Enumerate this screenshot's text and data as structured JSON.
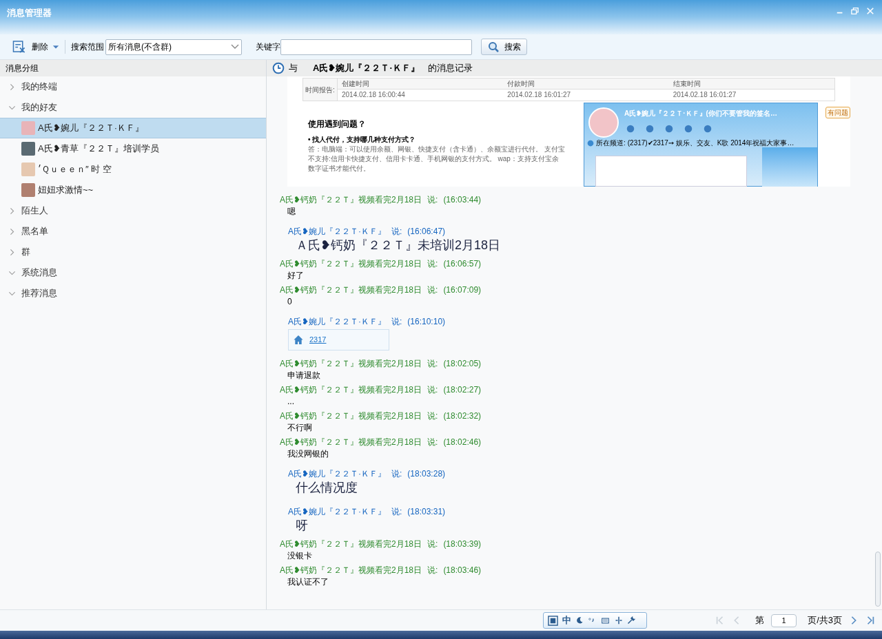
{
  "window": {
    "title": "消息管理器"
  },
  "toolbar": {
    "delete_label": "删除",
    "scope_label": "搜索范围",
    "scope_value": "所有消息(不含群)",
    "keyword_label": "关键字",
    "search_label": "搜索"
  },
  "sidebar": {
    "title": "消息分组",
    "groups": [
      {
        "label": "我的终端",
        "expanded": false
      },
      {
        "label": "我的好友",
        "expanded": true,
        "children": [
          {
            "label": "A氏❥婉儿『２２Ｔ·ＫＦ』",
            "selected": true
          },
          {
            "label": "A氏❥青草『２２Ｔ』培训学员",
            "selected": false
          },
          {
            "label": "׳Ｑｕｅｅｎ″ 时  空",
            "selected": false
          },
          {
            "label": "妞妞求激情~~",
            "selected": false
          }
        ]
      },
      {
        "label": "陌生人",
        "expanded": false
      },
      {
        "label": "黑名单",
        "expanded": false
      },
      {
        "label": "群",
        "expanded": false
      },
      {
        "label": "系统消息",
        "expanded": true
      },
      {
        "label": "推荐消息",
        "expanded": true
      }
    ]
  },
  "chat": {
    "header_prefix": "与",
    "header_name": "A氏❥婉儿『２２Ｔ·ＫＦ』",
    "header_suffix": "的消息记录",
    "embedded_image": {
      "table_label": "时间报告:",
      "columns": [
        "创建时间",
        "付款时间",
        "结束时间"
      ],
      "values": [
        "2014.02.18 16:00:44",
        "2014.02.18 16:01:27",
        "2014.02.18 16:01:27"
      ],
      "faq_title": "使用遇到问题？",
      "faq_question": "• 找人代付，支持哪几种支付方式？",
      "faq_lines": [
        "答：电脑端：可以使用余额、网银、快捷支付（含卡通）、余额宝进行代付。 支付宝",
        "不支持:信用卡快捷支付、信用卡卡通、手机网银的支付方式。 wap：支持支付宝余",
        "数字证书才能代付。"
      ],
      "side_tag": "有问题",
      "window_title": "A氏❥婉儿『２２Ｔ·ＫＦ』(你们不要管我的签名…",
      "channel_label": "所在频道:",
      "channel_text": "(2317)✔2317➙ 娱乐、交友、K歌 2014年祝福大家事…"
    },
    "messages": [
      {
        "kind": "incoming",
        "sender": "A氏❥钙奶『２２Ｔ』视频看完2月18日",
        "said": "说:",
        "time": "(16:03:44)",
        "body": {
          "kind": "text",
          "text": "嗯"
        }
      },
      {
        "kind": "outgoing",
        "sender": "A氏❥婉儿『２２Ｔ·ＫＦ』",
        "said": "说:",
        "time": "(16:06:47)",
        "body": {
          "kind": "large_text",
          "text": "Ａ氏❥钙奶『２２Ｔ』未培训2月18日"
        }
      },
      {
        "kind": "incoming",
        "sender": "A氏❥钙奶『２２Ｔ』视频看完2月18日",
        "said": "说:",
        "time": "(16:06:57)",
        "body": {
          "kind": "text",
          "text": "好了"
        }
      },
      {
        "kind": "incoming",
        "sender": "A氏❥钙奶『２２Ｔ』视频看完2月18日",
        "said": "说:",
        "time": "(16:07:09)",
        "body": {
          "kind": "text",
          "text": "0"
        }
      },
      {
        "kind": "outgoing",
        "sender": "A氏❥婉儿『２２Ｔ·ＫＦ』",
        "said": "说:",
        "time": "(16:10:10)",
        "body": {
          "kind": "link",
          "text": "2317"
        }
      },
      {
        "kind": "incoming",
        "sender": "A氏❥钙奶『２２Ｔ』视频看完2月18日",
        "said": "说:",
        "time": "(18:02:05)",
        "body": {
          "kind": "text",
          "text": "申请退款"
        }
      },
      {
        "kind": "incoming",
        "sender": "A氏❥钙奶『２２Ｔ』视频看完2月18日",
        "said": "说:",
        "time": "(18:02:27)",
        "body": {
          "kind": "text",
          "text": "..."
        }
      },
      {
        "kind": "incoming",
        "sender": "A氏❥钙奶『２２Ｔ』视频看完2月18日",
        "said": "说:",
        "time": "(18:02:32)",
        "body": {
          "kind": "text",
          "text": "不行啊"
        }
      },
      {
        "kind": "incoming",
        "sender": "A氏❥钙奶『２２Ｔ』视频看完2月18日",
        "said": "说:",
        "time": "(18:02:46)",
        "body": {
          "kind": "text",
          "text": "我没网银的"
        }
      },
      {
        "kind": "outgoing",
        "sender": "A氏❥婉儿『２２Ｔ·ＫＦ』",
        "said": "说:",
        "time": "(18:03:28)",
        "body": {
          "kind": "large_text",
          "text": "什么情况度"
        }
      },
      {
        "kind": "outgoing",
        "sender": "A氏❥婉儿『２２Ｔ·ＫＦ』",
        "said": "说:",
        "time": "(18:03:31)",
        "body": {
          "kind": "large_text",
          "text": "呀"
        }
      },
      {
        "kind": "incoming",
        "sender": "A氏❥钙奶『２２Ｔ』视频看完2月18日",
        "said": "说:",
        "time": "(18:03:39)",
        "body": {
          "kind": "text",
          "text": "没银卡"
        }
      },
      {
        "kind": "incoming",
        "sender": "A氏❥钙奶『２２Ｔ』视频看完2月18日",
        "said": "说:",
        "time": "(18:03:46)",
        "body": {
          "kind": "text",
          "text": "我认证不了"
        }
      }
    ]
  },
  "ime_bar": {
    "mode": "中"
  },
  "pagination": {
    "prefix": "第",
    "page": "1",
    "suffix": "页/共3页"
  }
}
